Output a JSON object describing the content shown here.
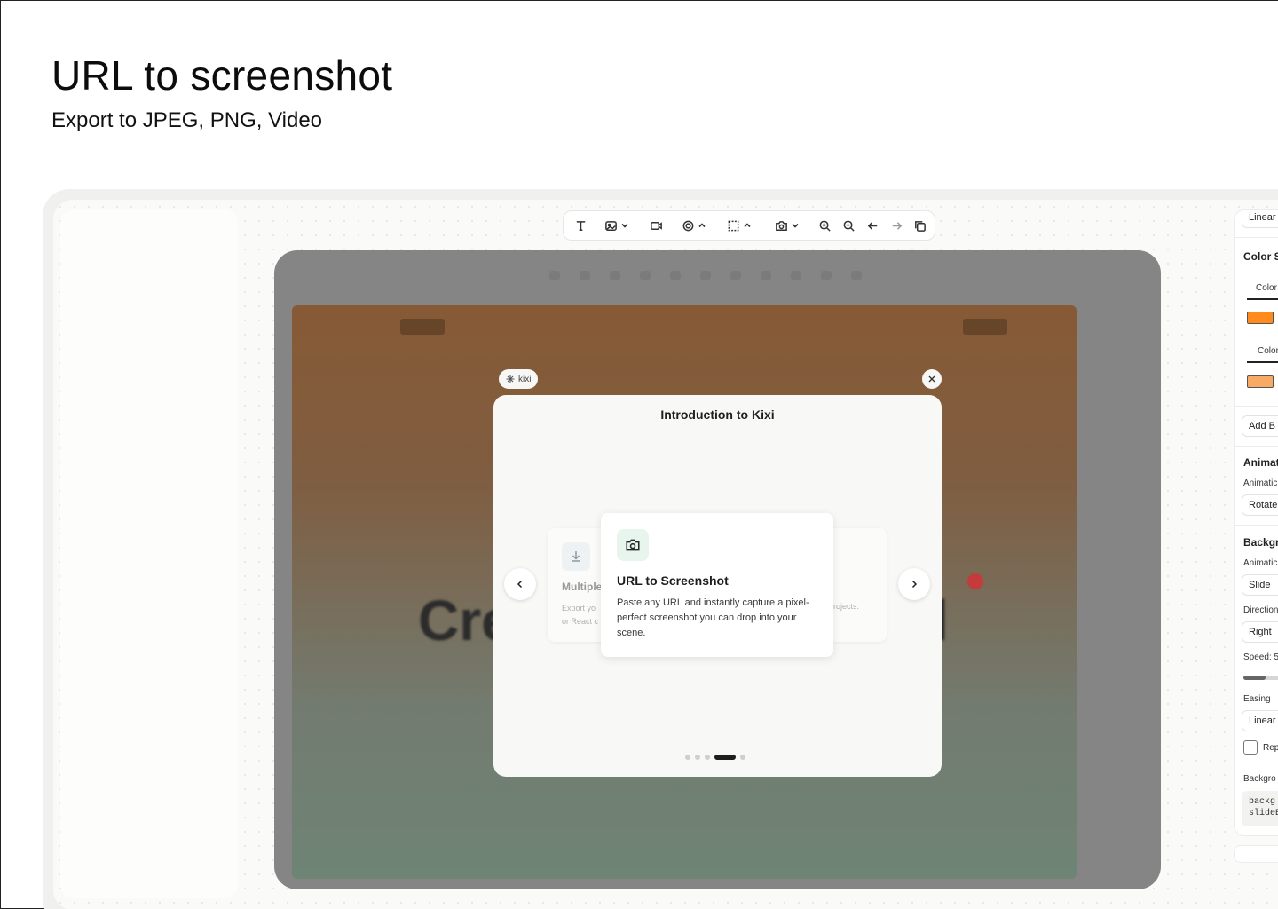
{
  "hero": {
    "title": "URL to screenshot",
    "subtitle": "Export to JPEG, PNG, Video"
  },
  "toolbar": {
    "buttons": [
      {
        "name": "text-tool",
        "icon": "text-icon",
        "dropdown": false
      },
      {
        "name": "image-tool",
        "icon": "image-icon",
        "dropdown": true
      },
      {
        "name": "video-tool",
        "icon": "video-icon",
        "dropdown": false
      },
      {
        "name": "effects-tool",
        "icon": "target-icon",
        "dropdown": true
      },
      {
        "name": "selection-tool",
        "icon": "selection-icon",
        "dropdown": true
      },
      {
        "name": "screenshot-tool",
        "icon": "camera-icon",
        "dropdown": true
      },
      {
        "name": "zoom-in",
        "icon": "zoom-in-icon",
        "dropdown": false
      },
      {
        "name": "zoom-out",
        "icon": "zoom-out-icon",
        "dropdown": false
      },
      {
        "name": "undo",
        "icon": "arrow-left-icon",
        "dropdown": false
      },
      {
        "name": "redo",
        "icon": "arrow-right-icon",
        "dropdown": false
      },
      {
        "name": "duplicate",
        "icon": "copy-icon",
        "dropdown": false
      }
    ]
  },
  "right_panel": {
    "top_select": "Linear",
    "color_section_title": "Color S",
    "color_tab_1": "Color",
    "color_1": "#ff8a1e",
    "color_tab_2": "Color",
    "color_2": "#f8a964",
    "add_button": "Add B",
    "animation_title": "Animat",
    "animation_label": "Animatic",
    "animation_value": "Rotate",
    "background_title": "Backgr",
    "bg_animation_label": "Animatic",
    "bg_animation_value": "Slide",
    "direction_label": "Direction",
    "direction_value": "Right",
    "speed_label": "Speed: 5",
    "speed_fraction": 0.5,
    "easing_label": "Easing",
    "easing_value": "Linear",
    "repeat_label": "Rep",
    "background_label": "Backgro",
    "code_line_1": "backg",
    "code_line_2": "slideB"
  },
  "preview": {
    "canvas_text_left": "Cre",
    "canvas_text_right": "l",
    "brand_pill": "kixi",
    "modal": {
      "title": "Introduction to Kixi",
      "left_card_title": "Multiple",
      "left_card_desc_1": "Export yo",
      "left_card_desc_2": "or React c",
      "right_card_desc": "rojects.",
      "main_card_title": "URL to Screenshot",
      "main_card_desc": "Paste any URL and instantly capture a pixel-perfect screenshot you can drop into your scene.",
      "active_slide": 4,
      "total_slides": 5
    }
  }
}
